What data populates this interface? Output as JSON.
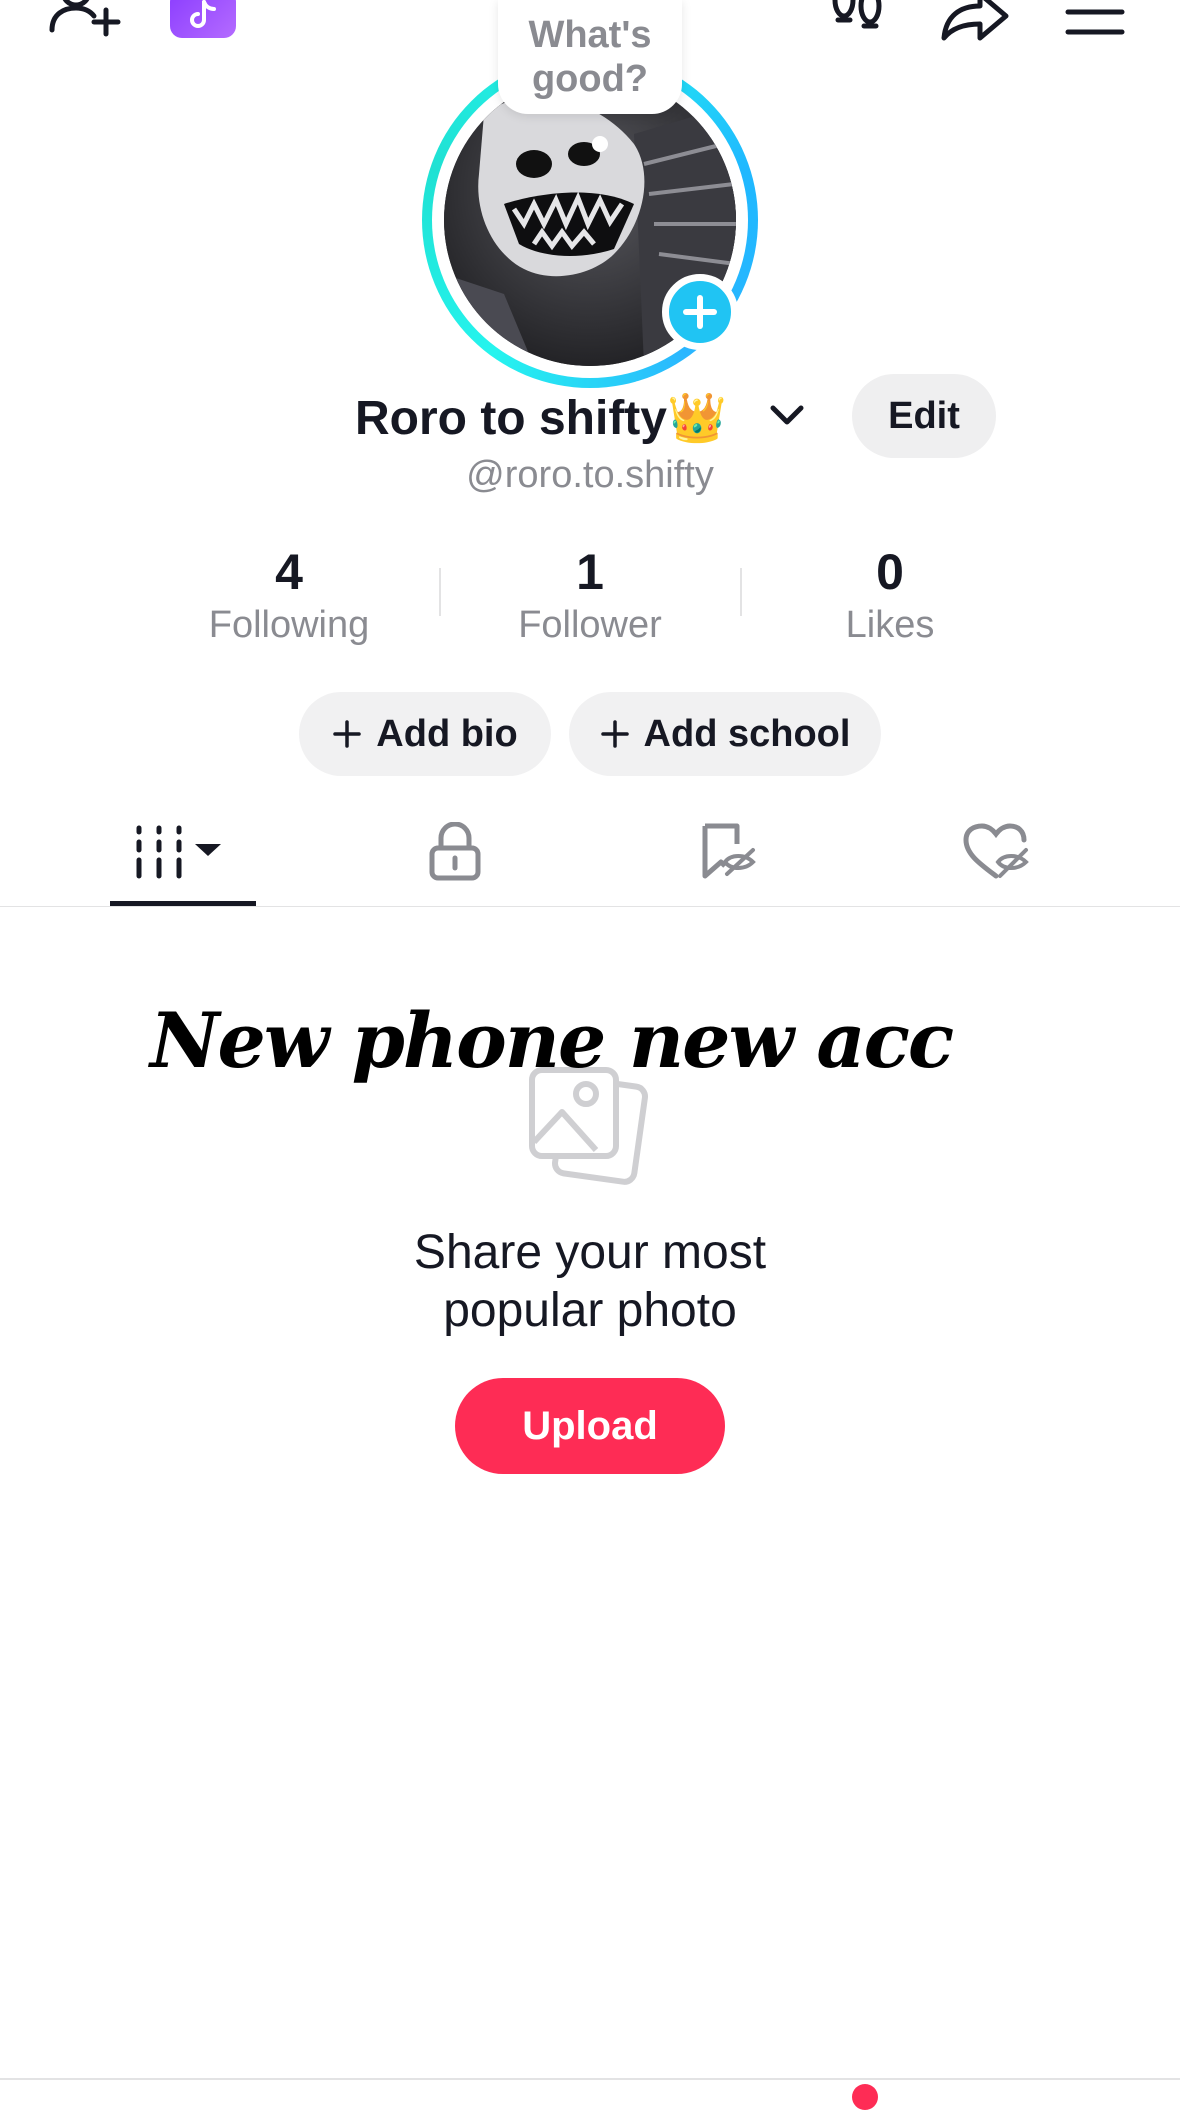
{
  "topbar": {
    "icons": [
      "add-friend-icon",
      "tiktok-badge-icon",
      "footprints-icon",
      "share-icon",
      "menu-icon"
    ]
  },
  "avatar": {
    "bubble_text_line1": "What's",
    "bubble_text_line2": "good?"
  },
  "profile": {
    "display_name": "Roro to shifty👑",
    "handle": "@roro.to.shifty",
    "edit_label": "Edit"
  },
  "stats": [
    {
      "value": "4",
      "label": "Following"
    },
    {
      "value": "1",
      "label": "Follower"
    },
    {
      "value": "0",
      "label": "Likes"
    }
  ],
  "pills": {
    "add_bio": "Add bio",
    "add_school": "Add school"
  },
  "tabs": [
    "videos-grid-tab",
    "private-tab",
    "saved-tab",
    "liked-tab"
  ],
  "empty_state": {
    "overlay_text": "New phone new acc",
    "title_line1": "Share your most",
    "title_line2": "popular photo",
    "upload_label": "Upload"
  },
  "colors": {
    "accent": "#fe2c55",
    "ring": "#25f4ee",
    "plus_badge": "#20c4f3",
    "text_secondary": "#8a8b91"
  }
}
